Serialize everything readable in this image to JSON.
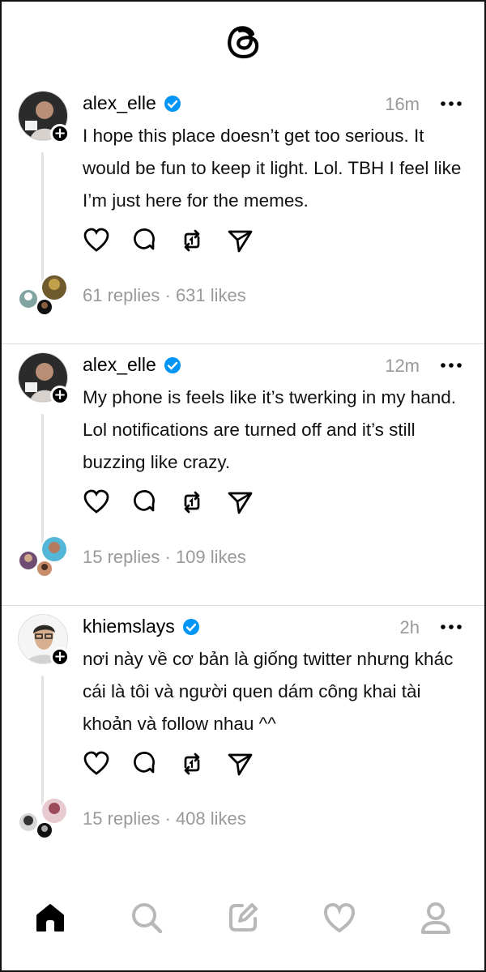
{
  "app": {
    "logo_icon": "threads-logo-icon"
  },
  "posts": [
    {
      "username": "alex_elle",
      "verified": true,
      "time": "16m",
      "text": "I hope this place doesn’t get too serious. It would be fun to keep it light. Lol. TBH I feel like I’m just here for the memes.",
      "stats": "61 replies · 631 likes",
      "avatar_icon": "profile-photo",
      "mini_avatars": [
        "replier-avatar",
        "replier-avatar",
        "replier-avatar"
      ]
    },
    {
      "username": "alex_elle",
      "verified": true,
      "time": "12m",
      "text": "My phone is feels like it’s twerking in my hand. Lol notifications are turned off and it’s still buzzing like crazy.",
      "stats": "15 replies · 109 likes",
      "avatar_icon": "profile-photo",
      "mini_avatars": [
        "replier-avatar",
        "replier-avatar",
        "replier-avatar"
      ]
    },
    {
      "username": "khiemslays",
      "verified": true,
      "time": "2h",
      "text": "nơi này về cơ bản là giống twitter nhưng khác cái là tôi và người quen dám công khai tài khoản và follow nhau ^^",
      "stats": "15 replies · 408 likes",
      "avatar_icon": "profile-photo",
      "mini_avatars": [
        "replier-avatar",
        "replier-avatar",
        "replier-avatar"
      ]
    }
  ],
  "tabs": [
    {
      "icon": "home-icon",
      "active": true
    },
    {
      "icon": "search-icon",
      "active": false
    },
    {
      "icon": "compose-icon",
      "active": false
    },
    {
      "icon": "heart-icon",
      "active": false
    },
    {
      "icon": "profile-icon",
      "active": false
    }
  ],
  "colors": {
    "verified": "#0095f6",
    "muted": "#999999",
    "divider": "#dedede"
  }
}
